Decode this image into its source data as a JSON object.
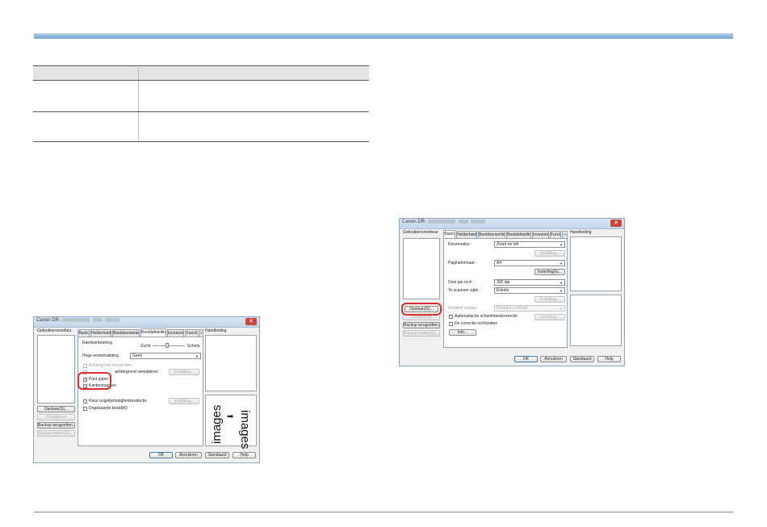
{
  "table": {
    "header": [
      "",
      ""
    ],
    "rows": [
      [
        "",
        ""
      ],
      [
        "",
        ""
      ]
    ]
  },
  "dialog_left": {
    "title": "Canon DR-",
    "left_panel_label": "Gebruikersvoorkeu",
    "tabs": [
      "Basis",
      "Helderheid",
      "Beeldverwerking",
      "Beeldafstelling",
      "Invoeren",
      "Functi"
    ],
    "manual_label": "Handleiding",
    "edge_label": "Randverbetering",
    "soft_label": "Zacht",
    "sharp_label": "Scherp",
    "highlight_label": "Hoge-endextraktiing",
    "highlight_value": "Geen",
    "bg_smooth_label": "Achtergrond verzachten",
    "bg_remove_label": "achtergrond verwijderen",
    "setting_btn": "Instelling...",
    "punch_label": "Punt gaten",
    "borders_label": "Kantenmagnen",
    "moire_label": "Kleur ongelijkmatigheidsreductie",
    "doubleside_label": "Dogekaarde beeld(R)",
    "preview_top": "images",
    "preview_bottom": "images",
    "opslaan_btn": "Opslaan(S)...",
    "remove_btn": "Verwijderen",
    "backup_btn": "Backup terugzetten...",
    "backup_make_btn": "Backup maken(E)...",
    "ok_btn": "OK",
    "cancel_btn": "Annuleren",
    "standard_btn": "Standaard",
    "help_btn": "Help"
  },
  "dialog_right": {
    "title": "Canon DR-",
    "left_panel_label": "Gebruikersvoorkeur",
    "tabs": [
      "Basis",
      "Helderheid",
      "Beeldverwerking",
      "Beeldafstelling",
      "Invoeren",
      "Functie"
    ],
    "manual_label": "Handleiding",
    "colormode_label": "Kleurmodus :",
    "colormode_value": "Zwart en wit",
    "pagesize_label": "Paginaformaat :",
    "pagesize_value": "A4",
    "dpi_label": "Dots per inch :",
    "dpi_value": "300 dpi",
    "side_label": "Te scannen zijde :",
    "side_value": "Enkele",
    "quality_label": "Kwaliteit modus",
    "quality_value": "Prioriteit snelheid",
    "autosize_label": "Automatische scheefstandcorrectie",
    "deskew_label": "De correctie rechtzetten",
    "setting_btn": "Instelling...",
    "setting_btn_b": "Instelling(E)...",
    "info_btn": "Info...",
    "opslaan_btn": "Opslaan(S)...",
    "remove_btn": "Verwijderen",
    "backup_btn": "Backup terugzetten...",
    "backup_make_btn": "Backup maken(E)...",
    "ok_btn": "OK",
    "cancel_btn": "Annuleren",
    "standard_btn": "Standaard",
    "help_btn": "Help"
  }
}
